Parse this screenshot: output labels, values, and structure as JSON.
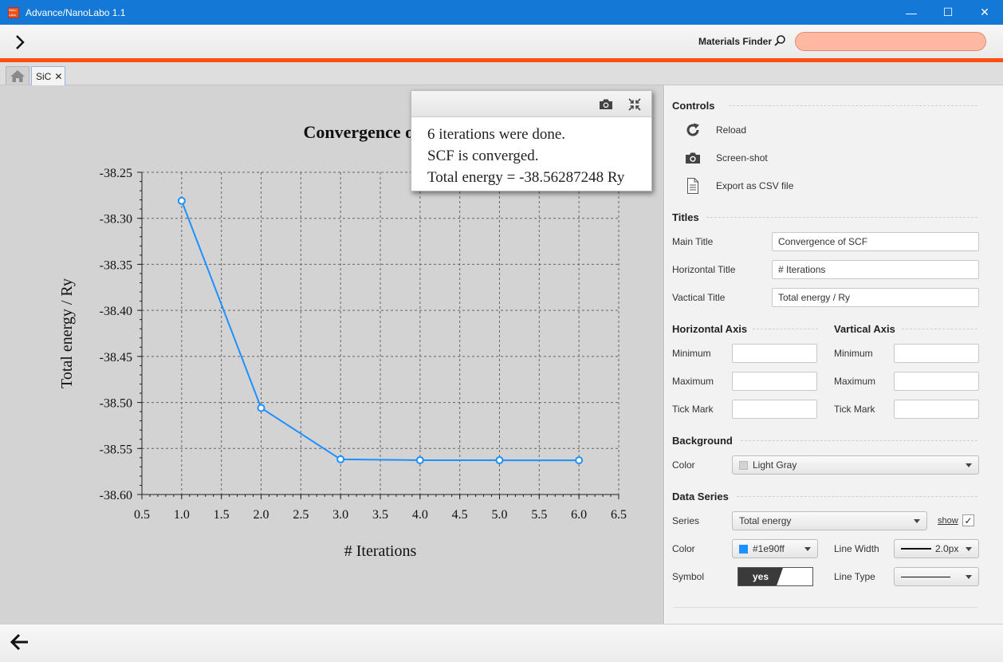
{
  "window": {
    "title": "Advance/NanoLabo 1.1",
    "icon_label": "Nano Labo",
    "minimize_glyph": "—",
    "maximize_glyph": "☐",
    "close_glyph": "✕"
  },
  "header": {
    "nav_glyph": "›",
    "finder_label": "Materials Finder",
    "finder_value": "",
    "accent_color": "#ff4e12"
  },
  "tabs": [
    {
      "label": "",
      "icon": "home-icon"
    },
    {
      "label": "SiC",
      "close_glyph": "✕"
    }
  ],
  "popup": {
    "lines": [
      "6 iterations were done.",
      "SCF is converged.",
      "Total energy = -38.56287248 Ry"
    ]
  },
  "chart_data": {
    "type": "line",
    "title": "Convergence of SCF",
    "xlabel": "# Iterations",
    "ylabel": "Total energy / Ry",
    "xlim": [
      0.5,
      6.5
    ],
    "ylim": [
      -38.6,
      -38.25
    ],
    "x_ticks": [
      "0.5",
      "1.0",
      "1.5",
      "2.0",
      "2.5",
      "3.0",
      "3.5",
      "4.0",
      "4.5",
      "5.0",
      "5.5",
      "6.0",
      "6.5"
    ],
    "y_ticks": [
      "-38.25",
      "-38.30",
      "-38.35",
      "-38.40",
      "-38.45",
      "-38.50",
      "-38.55",
      "-38.60"
    ],
    "grid": true,
    "background": "#d3d3d3",
    "series": [
      {
        "name": "Total energy",
        "color": "#1e90ff",
        "x": [
          1,
          2,
          3,
          4,
          5,
          6
        ],
        "y": [
          -38.281,
          -38.506,
          -38.5618,
          -38.5627,
          -38.5628,
          -38.56287
        ]
      }
    ]
  },
  "panel": {
    "controls": {
      "heading": "Controls",
      "reload": "Reload",
      "screenshot": "Screen-shot",
      "export": "Export as CSV file"
    },
    "titles": {
      "heading": "Titles",
      "main_label": "Main Title",
      "main_value": "Convergence of SCF",
      "horizontal_label": "Horizontal Title",
      "horizontal_value": "# Iterations",
      "vertical_label": "Vactical Title",
      "vertical_value": "Total energy / Ry"
    },
    "haxis": {
      "heading": "Horizontal Axis",
      "min_label": "Minimum",
      "max_label": "Maximum",
      "tick_label": "Tick Mark"
    },
    "vaxis": {
      "heading": "Vartical Axis",
      "min_label": "Minimum",
      "max_label": "Maximum",
      "tick_label": "Tick Mark"
    },
    "background": {
      "heading": "Background",
      "color_label": "Color",
      "color_value": "Light Gray",
      "color_swatch": "#d3d3d3"
    },
    "series": {
      "heading": "Data Series",
      "series_label": "Series",
      "series_value": "Total energy",
      "show_label": "show",
      "show_checked": "✓",
      "color_label": "Color",
      "color_value": "#1e90ff",
      "line_width_label": "Line Width",
      "line_width_value": "2.0px",
      "symbol_label": "Symbol",
      "symbol_value": "yes",
      "line_type_label": "Line Type"
    }
  },
  "footer": {
    "back_glyph": "←"
  }
}
